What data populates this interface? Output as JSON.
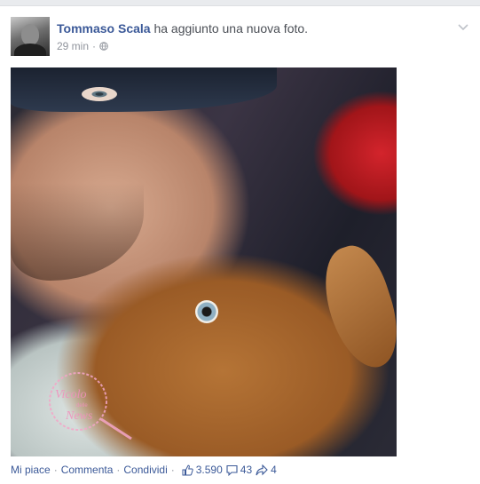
{
  "post": {
    "author": "Tommaso Scala",
    "action": "ha aggiunto una nuova foto.",
    "time": "29 min",
    "meta_separator": "·"
  },
  "photo": {
    "watermark_text": "Vicolo delle News"
  },
  "actions": {
    "like": "Mi piace",
    "comment": "Comment",
    "comment_suffix": "a",
    "share": "Condividi",
    "separator": "·",
    "likes_count": "3.590",
    "comments_count": "43",
    "shares_count": "4"
  },
  "colors": {
    "link": "#3b5998",
    "muted": "#90949c",
    "page_bg": "#e9ebee"
  },
  "icons": [
    "globe-icon",
    "chevron-down-icon",
    "thumbs-up-icon",
    "comment-icon",
    "share-icon"
  ]
}
